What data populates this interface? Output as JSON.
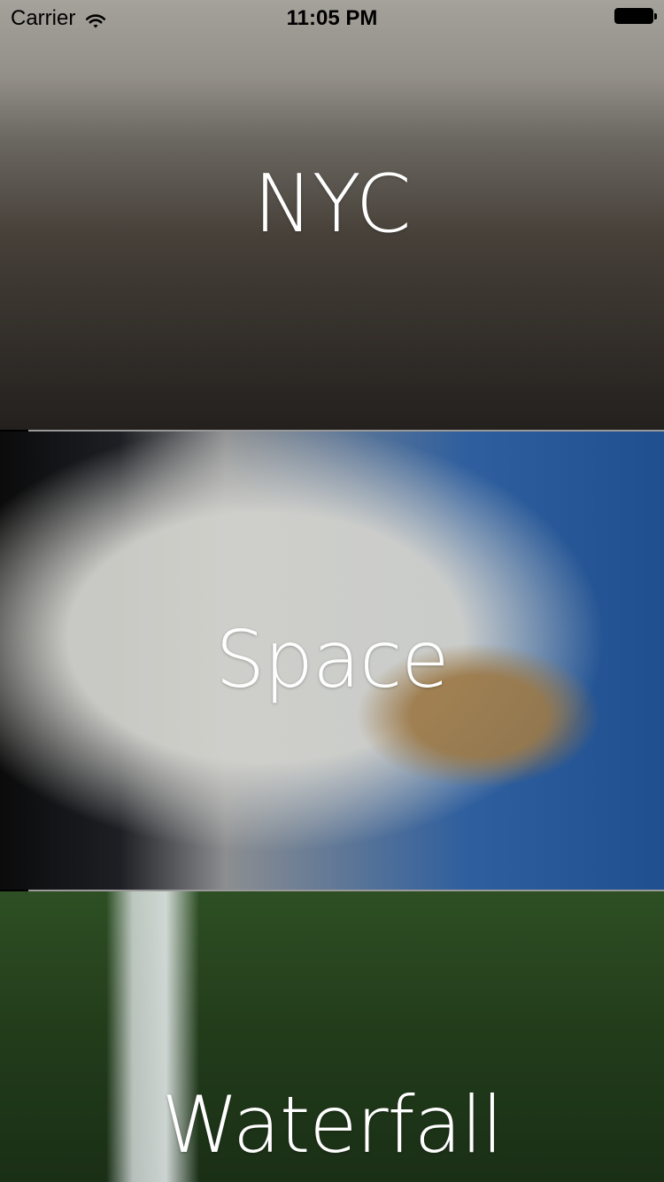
{
  "status_bar": {
    "carrier": "Carrier",
    "time": "11:05 PM"
  },
  "rows": [
    {
      "label": "NYC"
    },
    {
      "label": "Space"
    },
    {
      "label": "Waterfall"
    }
  ],
  "icons": {
    "wifi": "wifi-icon",
    "battery": "battery-icon"
  }
}
